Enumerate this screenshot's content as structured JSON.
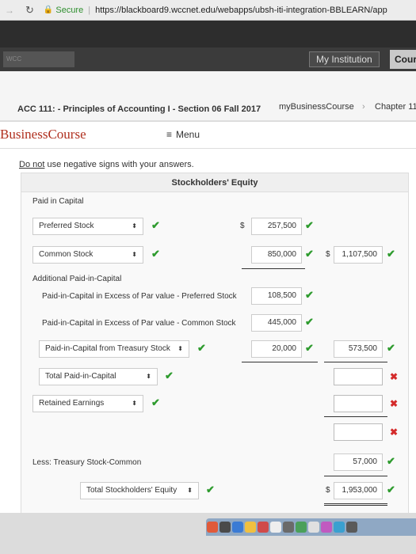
{
  "browser": {
    "secure_label": "Secure",
    "url": "https://blackboard9.wccnet.edu/webapps/ubsh-iti-integration-BBLEARN/app"
  },
  "institution_bar": {
    "my_institution": "My Institution",
    "courses": "Cour"
  },
  "course_header": {
    "title": "ACC 111: - Principles of Accounting I - Section 06 Fall 2017",
    "breadcrumb_1": "myBusinessCourse",
    "breadcrumb_2": "Chapter 11"
  },
  "app_bar": {
    "logo": "BusinessCourse",
    "menu_label": "Menu"
  },
  "instruction": {
    "emphasis": "Do not",
    "rest": " use negative signs with your answers."
  },
  "statement": {
    "heading": "Stockholders' Equity",
    "paid_in_capital_label": "Paid in Capital",
    "preferred_stock": {
      "label": "Preferred Stock",
      "amount": "257,500",
      "dollar": "$"
    },
    "common_stock": {
      "label": "Common Stock",
      "amount": "850,000",
      "total_dollar": "$",
      "total": "1,107,500"
    },
    "apic_label": "Additional Paid-in-Capital",
    "apic_preferred": {
      "label": "Paid-in-Capital in Excess of Par value - Preferred Stock",
      "amount": "108,500"
    },
    "apic_common": {
      "label": "Paid-in-Capital in Excess of Par value - Common Stock",
      "amount": "445,000"
    },
    "apic_treasury": {
      "label": "Paid-in-Capital from Treasury Stock",
      "amount": "20,000",
      "total": "573,500"
    },
    "total_paid_in": {
      "label": "Total Paid-in-Capital",
      "amount": ""
    },
    "retained_earnings": {
      "label": "Retained Earnings",
      "amount": ""
    },
    "subtotal": {
      "amount": ""
    },
    "treasury_stock": {
      "label": "Less: Treasury Stock-Common",
      "amount": "57,000"
    },
    "total_equity": {
      "label": "Total Stockholders' Equity",
      "dollar": "$",
      "amount": "1,953,000"
    }
  },
  "colors": {
    "check": "#2e9b2e",
    "cross": "#d42b2b",
    "brand": "#b0301f"
  }
}
